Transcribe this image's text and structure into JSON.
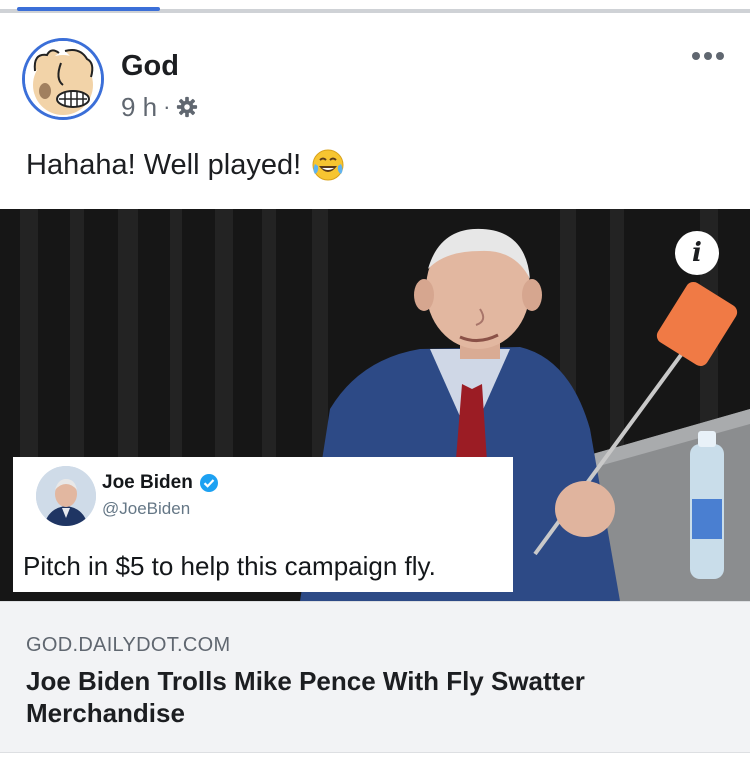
{
  "post": {
    "author": "God",
    "time": "9 h",
    "separator": "·",
    "text": "Hahaha! Well played!",
    "emoji": "tears-of-joy-emoji",
    "privacy_icon": "gear-icon",
    "more_icon": "more-options-icon"
  },
  "image": {
    "info_icon": "info-icon",
    "info_glyph": "i",
    "tweet": {
      "name": "Joe Biden",
      "handle": "@JoeBiden",
      "verified_icon": "verified-badge-icon",
      "text": "Pitch in $5 to help this campaign fly."
    }
  },
  "link": {
    "domain": "GOD.DAILYDOT.COM",
    "title": "Joe Biden Trolls Mike Pence With Fly Swatter Merchandise"
  },
  "colors": {
    "accent": "#3b6fd8",
    "text": "#1c1e21",
    "secondary": "#606770",
    "card_bg": "#f2f3f5",
    "verified": "#1da1f2"
  }
}
